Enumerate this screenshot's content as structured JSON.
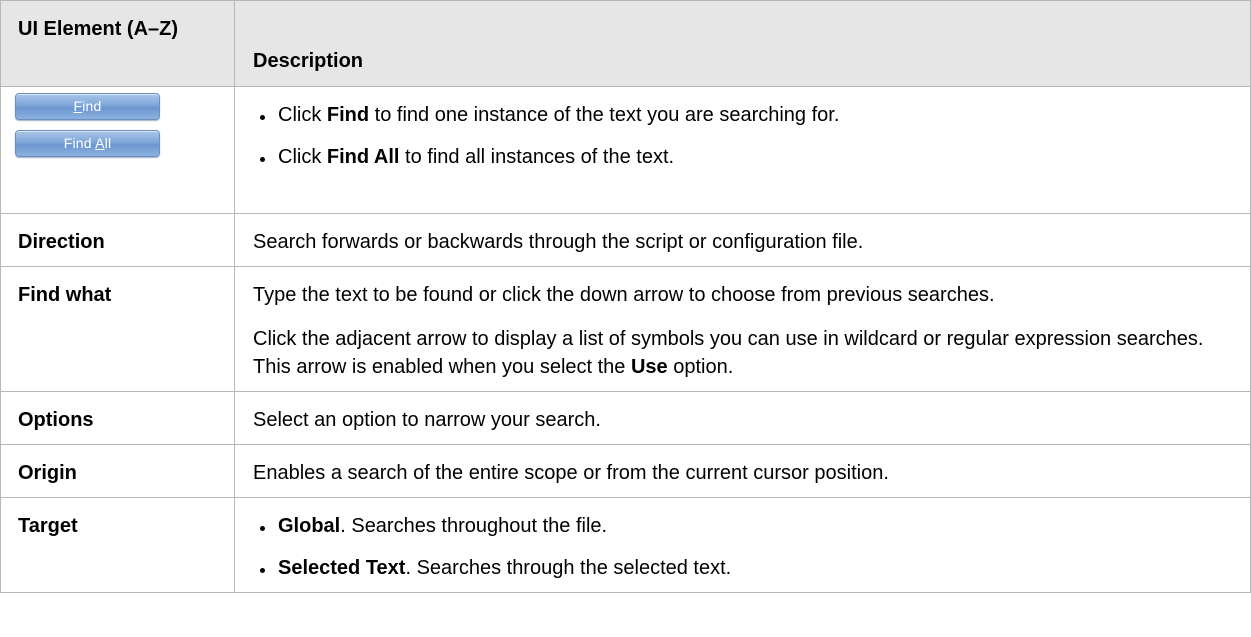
{
  "table": {
    "header": {
      "col1": "UI Element (A–Z)",
      "col2": "Description"
    },
    "rows": [
      {
        "buttons": [
          {
            "pre": "",
            "accel": "F",
            "post": "ind"
          },
          {
            "pre": "Find ",
            "accel": "A",
            "post": "ll"
          }
        ],
        "bullets": [
          {
            "pre": "Click ",
            "bold": "Find",
            "post": " to find one instance of the text you are searching for."
          },
          {
            "pre": "Click ",
            "bold": "Find All",
            "post": " to find all instances of the text."
          }
        ]
      },
      {
        "element": "Direction",
        "desc": "Search forwards or backwards through the script or configuration file."
      },
      {
        "element": "Find what",
        "p1": "Type the text to be found or click the down arrow to choose from previous searches.",
        "p2_pre": "Click the adjacent arrow to display a list of symbols you can use in wildcard or regular expression searches. This arrow is enabled when you select the ",
        "p2_bold": "Use",
        "p2_post": " option."
      },
      {
        "element": "Options",
        "desc": "Select an option to narrow your search."
      },
      {
        "element": "Origin",
        "desc": "Enables a search of the entire scope or from the current cursor position."
      },
      {
        "element": "Target",
        "bullets": [
          {
            "bold": "Global",
            "post": ". Searches throughout the file."
          },
          {
            "bold": "Selected Text",
            "post": ". Searches through the selected text."
          }
        ]
      }
    ]
  }
}
